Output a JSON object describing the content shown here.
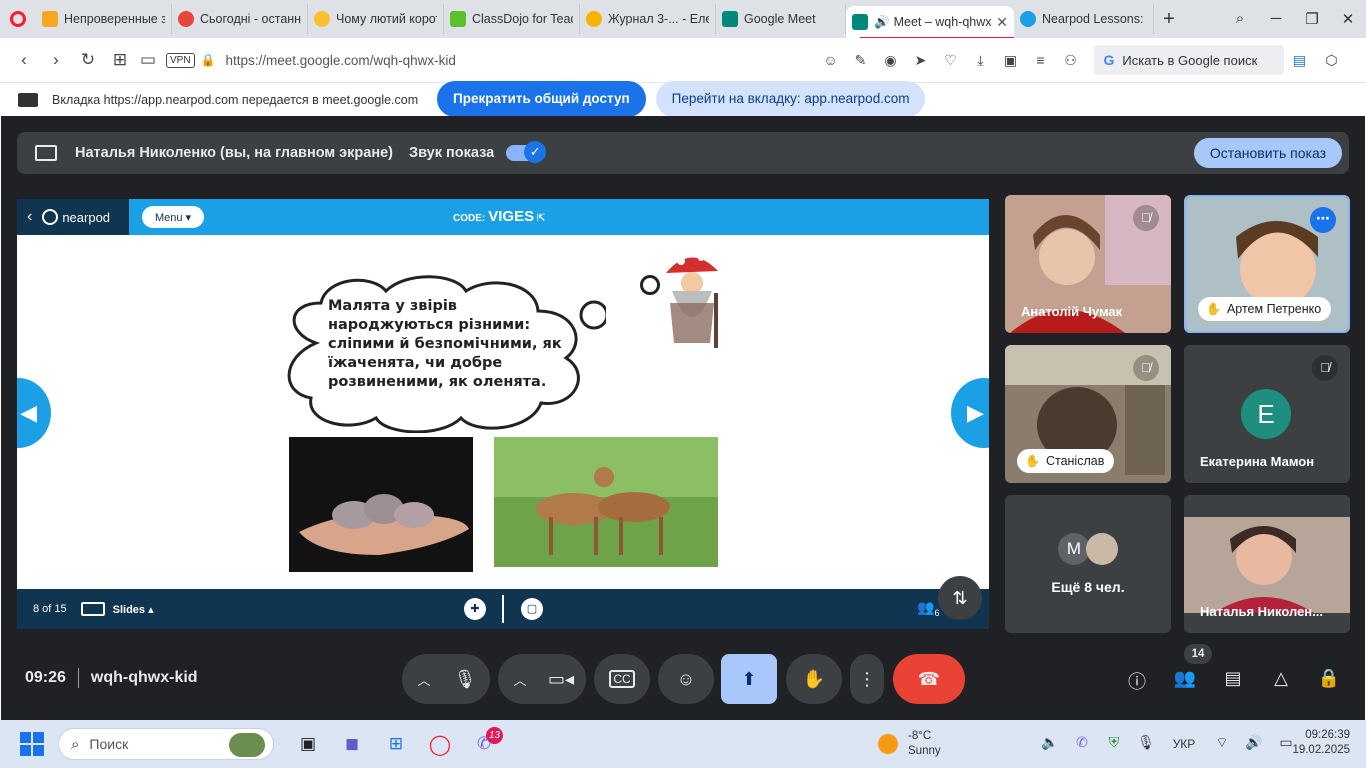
{
  "browser": {
    "tabs": [
      {
        "title": "Непроверенные за",
        "color": "#f5a623"
      },
      {
        "title": "Сьогодні - останній",
        "color": "#e8453c"
      },
      {
        "title": "Чому лютий корот",
        "color": "#fbc02d"
      },
      {
        "title": "ClassDojo for Teache",
        "color": "#58c12d"
      },
      {
        "title": "Журнал 3-... - Елект",
        "color": "#f6b400"
      },
      {
        "title": "Google Meet",
        "color": "#00897b"
      },
      {
        "title": "Meet – wqh-qhwx",
        "color": "#00897b",
        "active": true
      },
      {
        "title": "Nearpod Lessons: D",
        "color": "#1ba0e6"
      }
    ],
    "url": "https://meet.google.com/wqh-qhwx-kid",
    "vpn_label": "VPN",
    "search_label": "Искать в Google поиск",
    "search_logo": "G"
  },
  "share_banner": {
    "text": "Вкладка https://app.nearpod.com передается в meet.google.com",
    "stop_label": "Прекратить общий доступ",
    "goto_label": "Перейти на вкладку: app.nearpod.com"
  },
  "present_bar": {
    "presenter": "Наталья Николенко (вы, на главном экране)",
    "sound_label": "Звук показа",
    "stop_label": "Остановить показ"
  },
  "nearpod": {
    "logo_text": "nearpod",
    "menu_label": "Menu ▾",
    "code_label": "CODE:",
    "code_value": "VIGES",
    "slide_text": "Малята у звірів народжуються різними: сліпими й безпомічними, як їжаченята, чи добре розвиненими, як оленята.",
    "page_label": "8 of 15",
    "slides_label": "Slides ▴",
    "students_count": "6"
  },
  "participants": [
    {
      "name": "Анатолій Чумак"
    },
    {
      "name": "Артем Петренко"
    },
    {
      "name": "Станіслав"
    },
    {
      "name": "Екатерина Мамон",
      "initial": "E"
    },
    {
      "more_label": "Ещё 8 чел.",
      "initial": "M"
    },
    {
      "name": "Наталья Николен..."
    }
  ],
  "meeting": {
    "time": "09:26",
    "code": "wqh-qhwx-kid",
    "people_count": "14"
  },
  "taskbar": {
    "search_placeholder": "Поиск",
    "badge": "13",
    "temperature": "-8°C",
    "weather": "Sunny",
    "lang": "УКР",
    "time": "09:26:39",
    "date": "19.02.2025"
  },
  "colors": {
    "meet_bg": "#202124",
    "accent": "#1a73e8",
    "nearpod_blue": "#1ba0e6",
    "nearpod_dark": "#0f3550",
    "end_call": "#ea4335"
  }
}
